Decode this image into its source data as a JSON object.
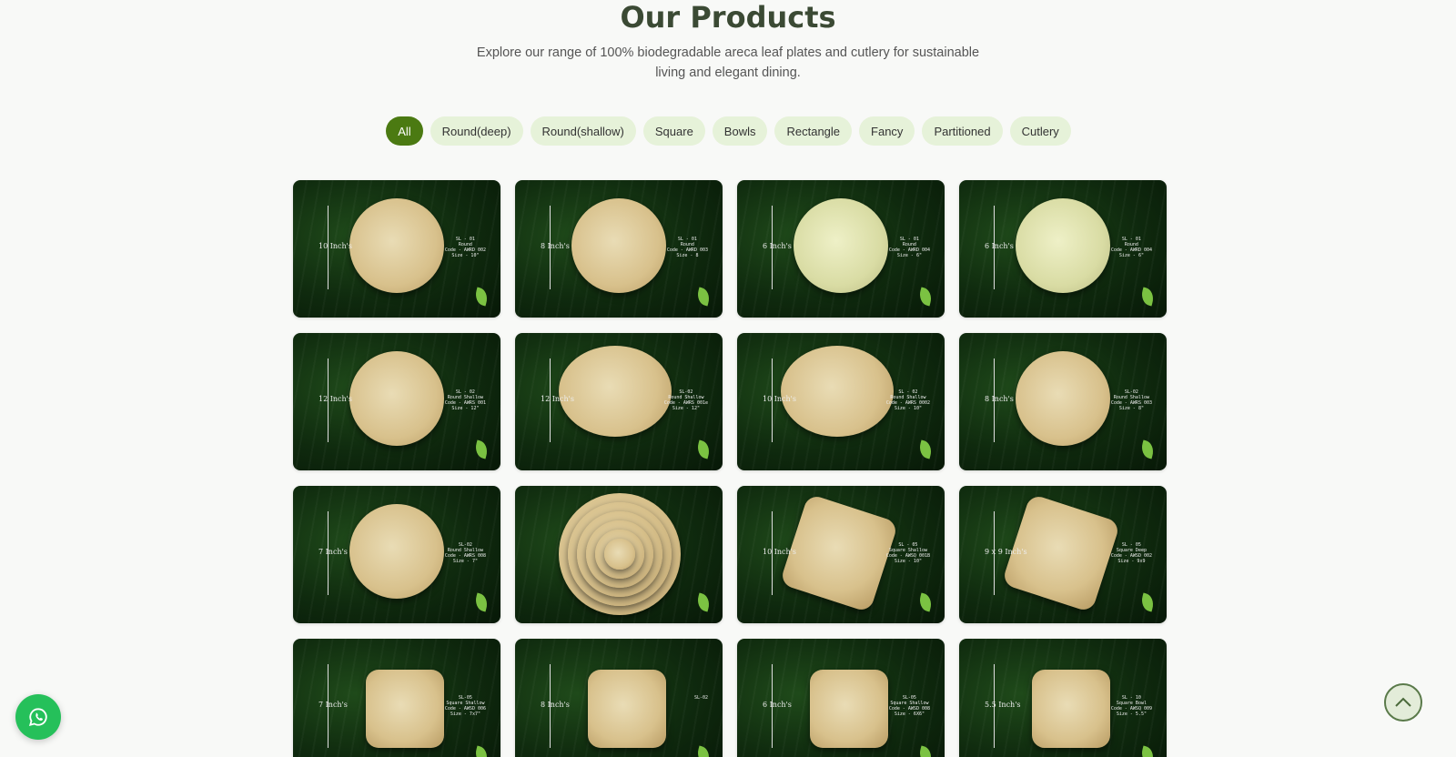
{
  "section": {
    "title": "Our Products",
    "subtitle": "Explore our range of 100% biodegradable areca leaf plates and cutlery for sustainable living and elegant dining."
  },
  "filters": [
    {
      "label": "All",
      "active": true
    },
    {
      "label": "Round(deep)",
      "active": false
    },
    {
      "label": "Round(shallow)",
      "active": false
    },
    {
      "label": "Square",
      "active": false
    },
    {
      "label": "Bowls",
      "active": false
    },
    {
      "label": "Rectangle",
      "active": false
    },
    {
      "label": "Fancy",
      "active": false
    },
    {
      "label": "Partitioned",
      "active": false
    },
    {
      "label": "Cutlery",
      "active": false
    }
  ],
  "products": [
    {
      "shape": "round",
      "size_label": "10 Inch's",
      "info": [
        "SL - 01",
        "Round",
        "Code - AWRD 002",
        "Size - 10\""
      ]
    },
    {
      "shape": "round",
      "size_label": "8 Inch's",
      "info": [
        "SL - 01",
        "Round",
        "Code - AWRD 003",
        "Size - 8"
      ]
    },
    {
      "shape": "round",
      "size_label": "6 Inch's",
      "info": [
        "SL - 01",
        "Round",
        "Code - AWRD 004",
        "Size - 6\""
      ]
    },
    {
      "shape": "round",
      "size_label": "6 Inch's",
      "info": [
        "SL - 01",
        "Round",
        "Code - AWRD 004",
        "Size - 6\""
      ]
    },
    {
      "shape": "round",
      "size_label": "12 Inch's",
      "info": [
        "SL - 02",
        "Round Shallow",
        "Code - AWRS 001",
        "Size - 12\""
      ]
    },
    {
      "shape": "oval",
      "size_label": "12 Inch's",
      "info": [
        "SL-02",
        "Round Shallow",
        "Code - AWRS 001e",
        "Size - 12\""
      ]
    },
    {
      "shape": "oval",
      "size_label": "10 Inch's",
      "info": [
        "SL - 02",
        "Round Shallow",
        "Code - AWRS 0002",
        "Size - 10\""
      ]
    },
    {
      "shape": "round",
      "size_label": "8 Inch's",
      "info": [
        "SL-02",
        "Round Shallow",
        "Code - AWRS 003",
        "Size - 8\""
      ]
    },
    {
      "shape": "round",
      "size_label": "7 Inch's",
      "info": [
        "SL-02",
        "Round Shallow",
        "Code - AWRS 008",
        "Size - 7\""
      ]
    },
    {
      "shape": "stack",
      "size_label": "",
      "info": []
    },
    {
      "shape": "diamond",
      "size_label": "10 Inch's",
      "info": [
        "SL - 05",
        "Square Shallow",
        "Code - AWSQ 001B",
        "Size - 10\""
      ]
    },
    {
      "shape": "diamond",
      "size_label": "9 x 9 Inch's",
      "info": [
        "SL - 05",
        "Square Deep",
        "Code - AWSD 002",
        "Size - 9x9"
      ]
    },
    {
      "shape": "square",
      "size_label": "7 Inch's",
      "info": [
        "SL-05",
        "Square Shallow",
        "Code - AWSD 006",
        "Size - 7x7\""
      ]
    },
    {
      "shape": "square",
      "size_label": "8 Inch's",
      "info": [
        "SL-02"
      ]
    },
    {
      "shape": "square",
      "size_label": "6 Inch's",
      "info": [
        "SL-05",
        "Square Shallow",
        "Code - AWSD 008",
        "Size - 6X6\""
      ]
    },
    {
      "shape": "square",
      "size_label": "5.5 Inch's",
      "info": [
        "SL - 10",
        "Square Bowl",
        "Code - AWSQ 009",
        "Size - 5.5\""
      ]
    }
  ],
  "floating": {
    "whatsapp_icon": "whatsapp-icon",
    "scroll_top_icon": "chevron-up-icon"
  }
}
